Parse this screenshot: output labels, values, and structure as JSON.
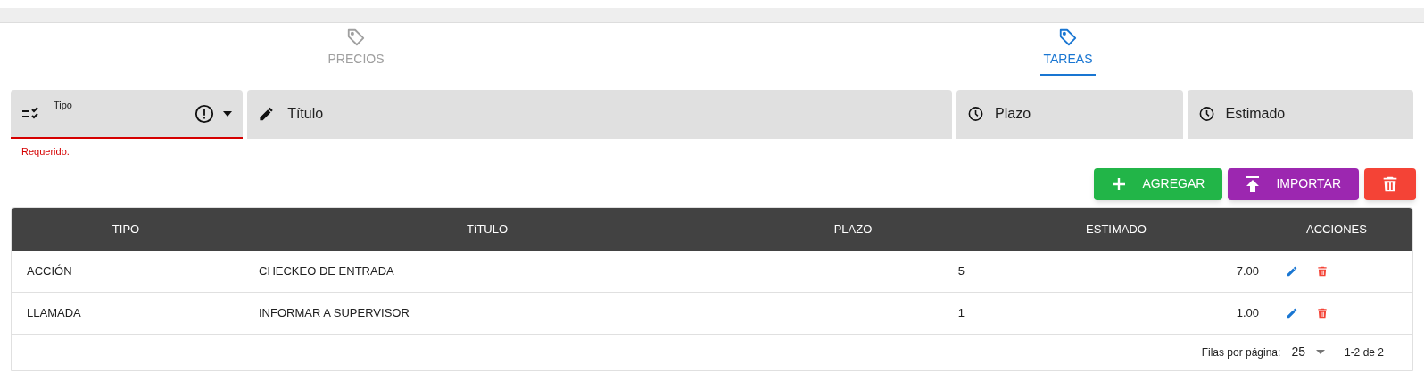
{
  "tabs": [
    {
      "label": "PRECIOS",
      "selected": false
    },
    {
      "label": "TAREAS",
      "selected": true
    }
  ],
  "fields": [
    {
      "kind": "select",
      "label": "Tipo",
      "error": true,
      "helper": "Requerido."
    },
    {
      "kind": "text",
      "placeholder": "Título"
    },
    {
      "kind": "time",
      "placeholder": "Plazo"
    },
    {
      "kind": "time",
      "placeholder": "Estimado"
    }
  ],
  "buttons": [
    {
      "kind": "add",
      "label": "AGREGAR"
    },
    {
      "kind": "import",
      "label": "IMPORTAR"
    },
    {
      "kind": "delete"
    }
  ],
  "table": {
    "columns": [
      "TIPO",
      "TíTULO",
      "PLAZO",
      "ESTIMADO",
      "ACCIONES"
    ],
    "rows": [
      {
        "tipo": "ACCIÓN",
        "titulo": "CHECKEO DE ENTRADA",
        "plazo": "5",
        "estimado": "7.00"
      },
      {
        "tipo": "LLAMADA",
        "titulo": "INFORMAR A SUPERVISOR",
        "plazo": "1",
        "estimado": "1.00"
      }
    ]
  },
  "pagination": {
    "label": "Filas por página:",
    "rows_per_page": "25",
    "range": "1-2 de 2"
  }
}
